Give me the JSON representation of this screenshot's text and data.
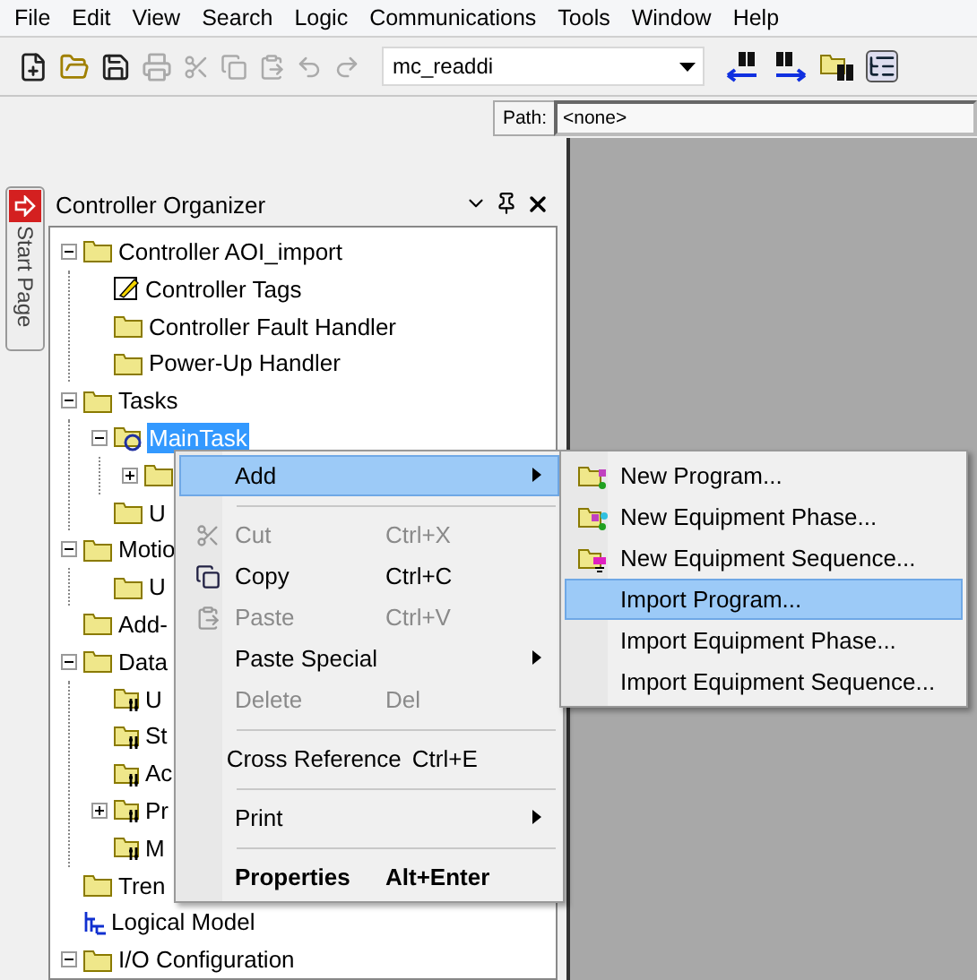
{
  "menu_bar": [
    "File",
    "Edit",
    "View",
    "Search",
    "Logic",
    "Communications",
    "Tools",
    "Window",
    "Help"
  ],
  "toolbar": {
    "search_value": "mc_readdi",
    "path_label": "Path:",
    "path_value": "<none>"
  },
  "start_tab": "Start Page",
  "organizer": {
    "title": "Controller Organizer",
    "tree": [
      {
        "label": "Controller AOI_import",
        "kind": "folder",
        "expanded": true,
        "children": [
          {
            "label": "Controller Tags",
            "kind": "tags"
          },
          {
            "label": "Controller Fault Handler",
            "kind": "folder"
          },
          {
            "label": "Power-Up Handler",
            "kind": "folder"
          }
        ]
      },
      {
        "label": "Tasks",
        "kind": "folder",
        "expanded": true,
        "children": [
          {
            "label": "MainTask",
            "kind": "task",
            "expanded": true,
            "selected": true,
            "children": [
              {
                "kind": "folder",
                "expanded": false
              }
            ]
          },
          {
            "label": "U",
            "kind": "folder"
          }
        ]
      },
      {
        "label": "Motio",
        "kind": "folder",
        "expanded": true,
        "children": [
          {
            "label": "U",
            "kind": "folder"
          }
        ]
      },
      {
        "label": "Add-",
        "kind": "folder"
      },
      {
        "label": "Data",
        "kind": "folder",
        "expanded": true,
        "children": [
          {
            "label": "U",
            "kind": "datatype"
          },
          {
            "label": "St",
            "kind": "datatype"
          },
          {
            "label": "Ac",
            "kind": "datatype"
          },
          {
            "label": "Pr",
            "kind": "datatype",
            "expanded": false
          },
          {
            "label": "M",
            "kind": "datatype"
          }
        ]
      },
      {
        "label": "Tren",
        "kind": "folder"
      },
      {
        "label": "Logical Model",
        "kind": "model"
      },
      {
        "label": "I/O Configuration",
        "kind": "folder",
        "expanded": true
      }
    ]
  },
  "context_menu": [
    {
      "kind": "item",
      "label": "Add",
      "submenu": true,
      "selected": true
    },
    {
      "kind": "separator"
    },
    {
      "kind": "item",
      "label": "Cut",
      "shortcut": "Ctrl+X",
      "disabled": true
    },
    {
      "kind": "item",
      "label": "Copy",
      "shortcut": "Ctrl+C",
      "disabled": false
    },
    {
      "kind": "item",
      "label": "Paste",
      "shortcut": "Ctrl+V",
      "disabled": true
    },
    {
      "kind": "item",
      "label": "Paste Special",
      "submenu": true
    },
    {
      "kind": "item",
      "label": "Delete",
      "shortcut": "Del",
      "disabled": true
    },
    {
      "kind": "separator"
    },
    {
      "kind": "item",
      "label": "Cross Reference",
      "shortcut": "Ctrl+E"
    },
    {
      "kind": "separator"
    },
    {
      "kind": "item",
      "label": "Print",
      "submenu": true
    },
    {
      "kind": "separator"
    },
    {
      "kind": "item",
      "label": "Properties",
      "shortcut": "Alt+Enter",
      "bold": true
    }
  ],
  "add_submenu": [
    {
      "label": "New Program...",
      "kind": "program",
      "selected": false
    },
    {
      "label": "New Equipment Phase...",
      "kind": "phase",
      "selected": false
    },
    {
      "label": "New Equipment Sequence...",
      "kind": "sequence",
      "selected": false
    },
    {
      "label": "Import Program...",
      "kind": "plain",
      "selected": true
    },
    {
      "label": "Import Equipment Phase...",
      "kind": "plain",
      "selected": false
    },
    {
      "label": "Import Equipment Sequence...",
      "kind": "plain",
      "selected": false
    }
  ]
}
